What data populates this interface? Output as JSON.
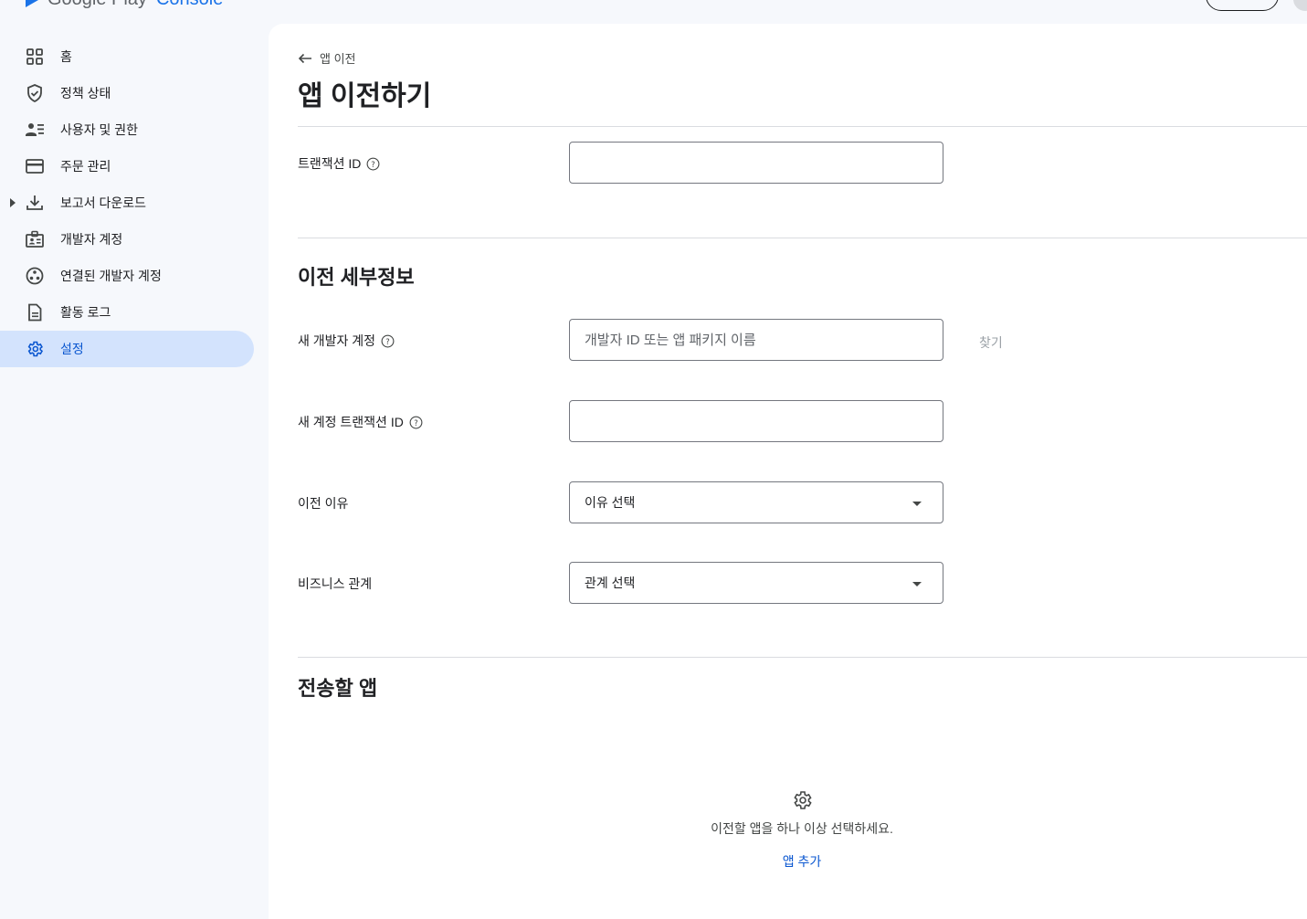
{
  "header": {
    "logo_text": "Google Play",
    "logo_accent": "Console"
  },
  "sidebar": {
    "items": [
      {
        "label": "홈",
        "icon": "dashboard-icon"
      },
      {
        "label": "정책 상태",
        "icon": "shield-check-icon"
      },
      {
        "label": "사용자 및 권한",
        "icon": "manage-accounts-icon"
      },
      {
        "label": "주문 관리",
        "icon": "credit-card-icon"
      },
      {
        "label": "보고서 다운로드",
        "icon": "download-icon",
        "expandable": true
      },
      {
        "label": "개발자 계정",
        "icon": "badge-icon"
      },
      {
        "label": "연결된 개발자 계정",
        "icon": "linked-accounts-icon"
      },
      {
        "label": "활동 로그",
        "icon": "document-icon"
      },
      {
        "label": "설정",
        "icon": "gear-icon",
        "active": true
      }
    ]
  },
  "page": {
    "back_label": "앱 이전",
    "title": "앱 이전하기"
  },
  "form": {
    "transaction_id_label": "트랜잭션 ID",
    "transaction_id_value": "",
    "details_title": "이전 세부정보",
    "new_account_label": "새 개발자 계정",
    "new_account_placeholder": "개발자 ID 또는 앱 패키지 이름",
    "find_label": "찾기",
    "new_transaction_id_label": "새 계정 트랜잭션 ID",
    "new_transaction_id_value": "",
    "reason_label": "이전 이유",
    "reason_value": "이유 선택",
    "relationship_label": "비즈니스 관계",
    "relationship_value": "관계 선택"
  },
  "apps_section": {
    "title": "전송할 앱",
    "empty_text": "이전할 앱을 하나 이상 선택하세요.",
    "add_label": "앱 추가"
  },
  "colors": {
    "accent": "#0b57d0",
    "active_nav_bg": "#d3e3fd",
    "background": "#f6f8fc"
  }
}
